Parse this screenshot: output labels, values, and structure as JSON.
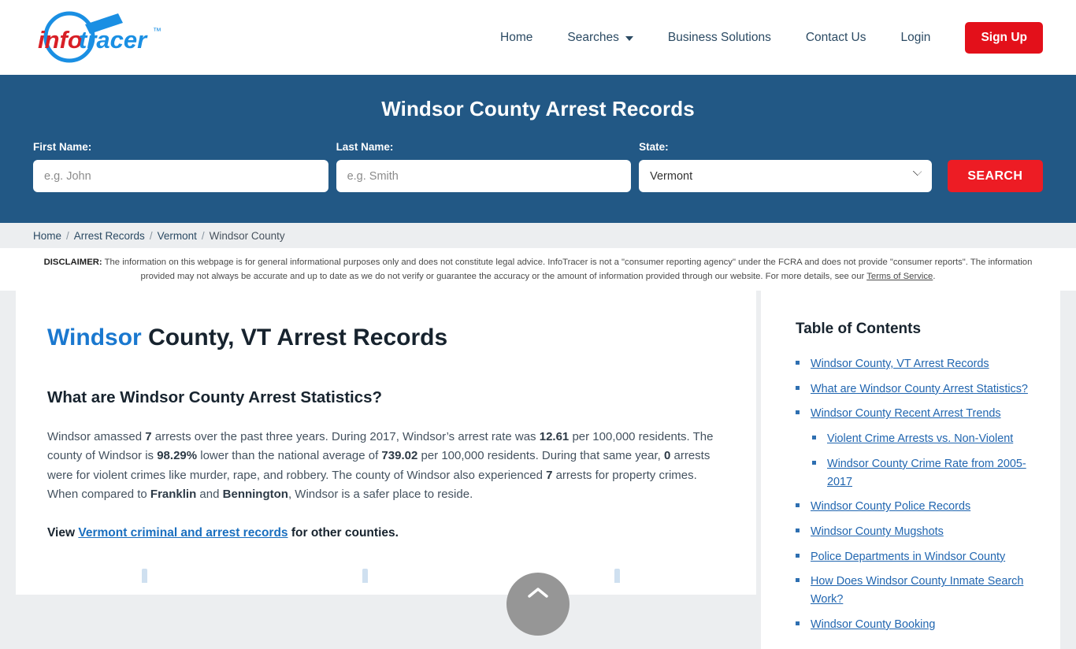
{
  "header": {
    "logo_text": "infotracer",
    "logo_tm": "™",
    "nav": [
      {
        "label": "Home",
        "icon": ""
      },
      {
        "label": "Searches",
        "icon": "chevron-down-icon"
      },
      {
        "label": "Business Solutions",
        "icon": ""
      },
      {
        "label": "Contact Us",
        "icon": ""
      },
      {
        "label": "Login",
        "icon": ""
      }
    ],
    "signup_label": "Sign Up"
  },
  "hero": {
    "title": "Windsor County Arrest Records",
    "first_name_label": "First Name:",
    "first_name_placeholder": "e.g. John",
    "first_name_value": "",
    "last_name_label": "Last Name:",
    "last_name_placeholder": "e.g. Smith",
    "last_name_value": "",
    "state_label": "State:",
    "state_selected": "Vermont",
    "search_label": "SEARCH"
  },
  "breadcrumb": {
    "items": [
      "Home",
      "Arrest Records",
      "Vermont",
      "Windsor County"
    ],
    "separator": "/"
  },
  "disclaimer": {
    "bold_prefix": "DISCLAIMER:",
    "body": " The information on this webpage is for general informational purposes only and does not constitute legal advice. InfoTracer is not a \"consumer reporting agency\" under the FCRA and does not provide \"consumer reports\". The information provided may not always be accurate and up to date as we do not verify or guarantee the accuracy or the amount of information provided through our website. For more details, see our ",
    "link_label": "Terms of Service",
    "tail": "."
  },
  "main": {
    "title_accent": "Windsor",
    "title_rest": " County, VT Arrest Records",
    "sub_head": "What are Windsor County Arrest Statistics?",
    "paragraph_parts": [
      {
        "text": "Windsor amassed ",
        "bold": false
      },
      {
        "text": "7",
        "bold": true
      },
      {
        "text": " arrests over the past three years. During 2017, Windsor’s arrest rate was ",
        "bold": false
      },
      {
        "text": "12.61",
        "bold": true
      },
      {
        "text": " per 100,000 residents. The county of Windsor is ",
        "bold": false
      },
      {
        "text": "98.29%",
        "bold": true
      },
      {
        "text": " lower than the national average of ",
        "bold": false
      },
      {
        "text": "739.02",
        "bold": true
      },
      {
        "text": " per 100,000 residents. During that same year, ",
        "bold": false
      },
      {
        "text": "0",
        "bold": true
      },
      {
        "text": " arrests were for violent crimes like murder, rape, and robbery. The county of Windsor also experienced ",
        "bold": false
      },
      {
        "text": "7",
        "bold": true
      },
      {
        "text": " arrests for property crimes. When compared to ",
        "bold": false
      },
      {
        "text": "Franklin",
        "bold": true
      },
      {
        "text": " and ",
        "bold": false
      },
      {
        "text": "Bennington",
        "bold": true
      },
      {
        "text": ", Windsor is a safer place to reside.",
        "bold": false
      }
    ],
    "view_prefix": "View ",
    "view_link": "Vermont criminal and arrest records",
    "view_suffix": " for other counties."
  },
  "toc": {
    "title": "Table of Contents",
    "items": [
      {
        "label": "Windsor County, VT Arrest Records",
        "level": 1
      },
      {
        "label": "What are Windsor County Arrest Statistics?",
        "level": 1
      },
      {
        "label": "Windsor County Recent Arrest Trends",
        "level": 1
      },
      {
        "label": "Violent Crime Arrests vs. Non-Violent",
        "level": 2
      },
      {
        "label": "Windsor County Crime Rate from 2005-2017",
        "level": 2
      },
      {
        "label": "Windsor County Police Records",
        "level": 1
      },
      {
        "label": "Windsor County Mugshots",
        "level": 1
      },
      {
        "label": "Police Departments in Windsor County",
        "level": 1
      },
      {
        "label": "How Does Windsor County Inmate Search Work?",
        "level": 1
      },
      {
        "label": "Windsor County Booking",
        "level": 1
      }
    ]
  },
  "scroll_top": {
    "icon": "chevron-up-icon"
  },
  "colors": {
    "hero_blue": "#225885",
    "brand_red": "#e3101a",
    "search_red": "#ed1c24",
    "link_blue": "#2166b0",
    "accent_blue": "#1a78cf",
    "page_bg": "#eceef0"
  }
}
